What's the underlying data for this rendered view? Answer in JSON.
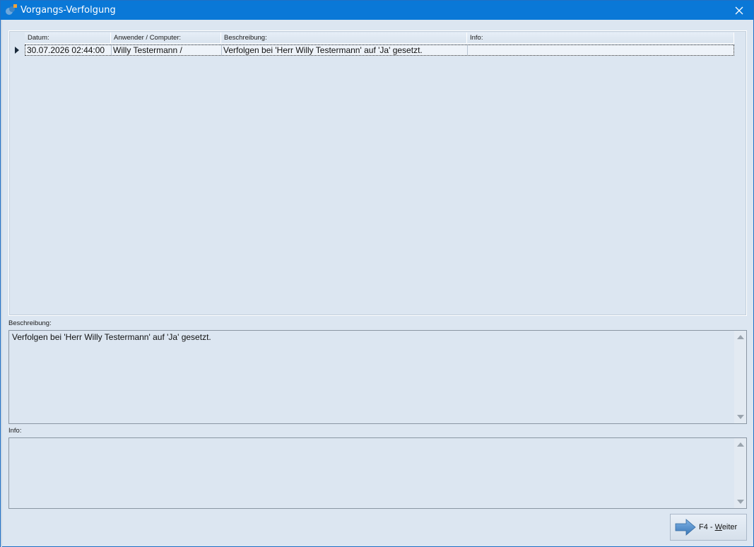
{
  "window": {
    "title": "Vorgangs-Verfolgung",
    "close_symbol": "✕",
    "accent_color": "#0a78d7",
    "background_color": "#dce6f1"
  },
  "grid": {
    "columns": [
      "Datum:",
      "Anwender / Computer:",
      "Beschreibung:",
      "Info:"
    ],
    "rows": [
      {
        "datum": "30.07.2026 02:44:00",
        "anwender": "Willy Testermann /",
        "beschreibung": "Verfolgen bei 'Herr Willy Testermann' auf 'Ja' gesetzt.",
        "info": ""
      }
    ]
  },
  "beschreibung": {
    "label": "Beschreibung:",
    "value": "Verfolgen bei 'Herr Willy Testermann' auf 'Ja' gesetzt."
  },
  "info": {
    "label": "Info:",
    "value": ""
  },
  "button": {
    "prefix": "F4 - ",
    "accel": "W",
    "rest": "eiter",
    "icon": "arrow-right-icon"
  }
}
